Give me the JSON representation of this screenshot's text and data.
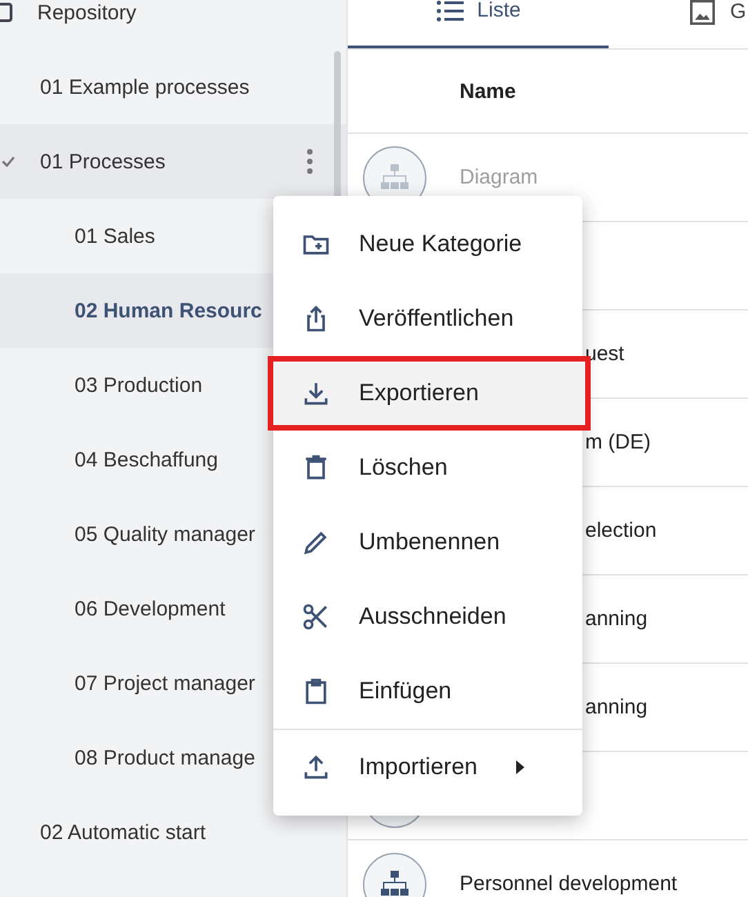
{
  "sidebar": {
    "items": [
      {
        "label": "Repository",
        "selected": false,
        "checked": false,
        "children": [
          {
            "label": "01 Example processes",
            "selected": false,
            "checked": false
          },
          {
            "label": "01 Processes",
            "selected": false,
            "checked": true,
            "expanded": true,
            "children": [
              {
                "label": "01 Sales",
                "selected": false,
                "checked": false
              },
              {
                "label": "02 Human Resourc",
                "selected": true,
                "checked": false
              },
              {
                "label": "03 Production",
                "selected": false,
                "checked": false
              },
              {
                "label": "04 Beschaffung",
                "selected": false,
                "checked": false
              },
              {
                "label": "05 Quality manager",
                "selected": false,
                "checked": false
              },
              {
                "label": "06 Development",
                "selected": false,
                "checked": false
              },
              {
                "label": "07 Project manager",
                "selected": false,
                "checked": false
              },
              {
                "label": "08 Product manage",
                "selected": false,
                "checked": false
              }
            ]
          },
          {
            "label": "02 Automatic start",
            "selected": false,
            "checked": false
          }
        ]
      }
    ]
  },
  "tabs": [
    {
      "label": "Liste",
      "selected": true
    },
    {
      "label": "G",
      "selected": false
    }
  ],
  "table": {
    "columns": [
      "Name"
    ],
    "rows": [
      {
        "kind": "full",
        "name": "Diagram",
        "muted": true
      },
      {
        "kind": "covered"
      },
      {
        "kind": "covered",
        "name": "uest"
      },
      {
        "kind": "covered",
        "name": "m (DE)"
      },
      {
        "kind": "covered",
        "name": "election"
      },
      {
        "kind": "covered",
        "name": "anning"
      },
      {
        "kind": "covered",
        "name": "anning"
      },
      {
        "kind": "icon-only"
      },
      {
        "kind": "full",
        "name": "Personnel development",
        "muted": false
      }
    ]
  },
  "context_menu": {
    "items": [
      {
        "label": "Neue Kategorie",
        "highlighted": false,
        "divider_before": false,
        "submenu": false
      },
      {
        "label": "Veröffentlichen",
        "highlighted": false,
        "divider_before": false,
        "submenu": false
      },
      {
        "label": "Exportieren",
        "highlighted": true,
        "divider_before": false,
        "submenu": false
      },
      {
        "label": "Löschen",
        "highlighted": false,
        "divider_before": false,
        "submenu": false
      },
      {
        "label": "Umbenennen",
        "highlighted": false,
        "divider_before": false,
        "submenu": false
      },
      {
        "label": "Ausschneiden",
        "highlighted": false,
        "divider_before": false,
        "submenu": false
      },
      {
        "label": "Einfügen",
        "highlighted": false,
        "divider_before": false,
        "submenu": false
      },
      {
        "label": "Importieren",
        "highlighted": false,
        "divider_before": true,
        "submenu": true
      }
    ]
  }
}
